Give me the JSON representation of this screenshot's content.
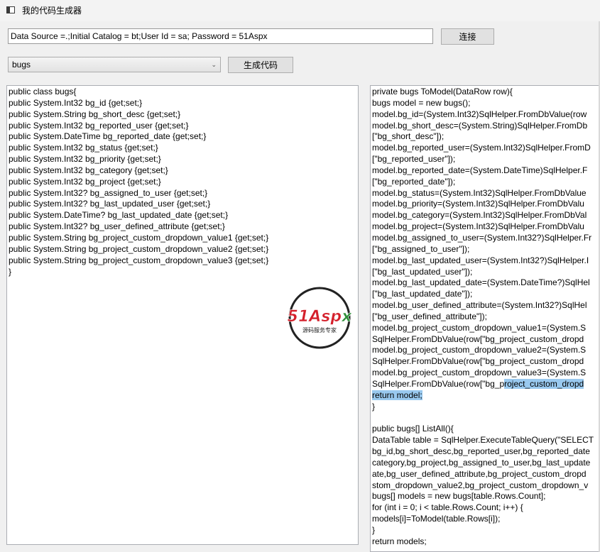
{
  "window": {
    "title": "我的代码生成器"
  },
  "connection": {
    "value": "Data Source =.;Initial Catalog = bt;User Id = sa; Password = 51Aspx",
    "connect_label": "连接"
  },
  "table_select": {
    "selected": "bugs"
  },
  "generate_label": "生成代码",
  "left_code": [
    "public class bugs{",
    "public System.Int32 bg_id {get;set;}",
    "public System.String bg_short_desc {get;set;}",
    "public System.Int32 bg_reported_user {get;set;}",
    "public System.DateTime bg_reported_date {get;set;}",
    "public System.Int32 bg_status {get;set;}",
    "public System.Int32 bg_priority {get;set;}",
    "public System.Int32 bg_category {get;set;}",
    "public System.Int32 bg_project {get;set;}",
    "public System.Int32? bg_assigned_to_user {get;set;}",
    "public System.Int32? bg_last_updated_user {get;set;}",
    "public System.DateTime? bg_last_updated_date {get;set;}",
    "public System.Int32? bg_user_defined_attribute {get;set;}",
    "public System.String bg_project_custom_dropdown_value1 {get;set;}",
    "public System.String bg_project_custom_dropdown_value2 {get;set;}",
    "public System.String bg_project_custom_dropdown_value3 {get;set;}",
    "}"
  ],
  "right_code": [
    "private bugs ToModel(DataRow row){",
    "bugs model = new bugs();",
    "model.bg_id=(System.Int32)SqlHelper.FromDbValue(row",
    "model.bg_short_desc=(System.String)SqlHelper.FromDb",
    "[\"bg_short_desc\"]);",
    "model.bg_reported_user=(System.Int32)SqlHelper.FromD",
    "[\"bg_reported_user\"]);",
    "model.bg_reported_date=(System.DateTime)SqlHelper.F",
    "[\"bg_reported_date\"]);",
    "model.bg_status=(System.Int32)SqlHelper.FromDbValue",
    "model.bg_priority=(System.Int32)SqlHelper.FromDbValu",
    "model.bg_category=(System.Int32)SqlHelper.FromDbVal",
    "model.bg_project=(System.Int32)SqlHelper.FromDbValu",
    "model.bg_assigned_to_user=(System.Int32?)SqlHelper.Fr",
    "[\"bg_assigned_to_user\"]);",
    "model.bg_last_updated_user=(System.Int32?)SqlHelper.I",
    "[\"bg_last_updated_user\"]);",
    "model.bg_last_updated_date=(System.DateTime?)SqlHel",
    "[\"bg_last_updated_date\"]);",
    "model.bg_user_defined_attribute=(System.Int32?)SqlHel",
    "[\"bg_user_defined_attribute\"]);",
    "model.bg_project_custom_dropdown_value1=(System.S",
    "SqlHelper.FromDbValue(row[\"bg_project_custom_dropd",
    "model.bg_project_custom_dropdown_value2=(System.S",
    "SqlHelper.FromDbValue(row[\"bg_project_custom_dropd",
    "model.bg_project_custom_dropdown_value3=(System.S",
    "SqlHelper.FromDbValue(row[\"bg_p",
    "return model;",
    "}",
    "",
    "public bugs[] ListAll(){",
    "DataTable table = SqlHelper.ExecuteTableQuery(\"SELECT",
    "bg_id,bg_short_desc,bg_reported_user,bg_reported_date",
    "category,bg_project,bg_assigned_to_user,bg_last_update",
    "ate,bg_user_defined_attribute,bg_project_custom_dropd",
    "stom_dropdown_value2,bg_project_custom_dropdown_v",
    "bugs[] models = new bugs[table.Rows.Count];",
    "for (int i = 0; i < table.Rows.Count; i++) {",
    "models[i]=ToModel(table.Rows[i]);",
    "}",
    "return models;"
  ],
  "right_code_selection": {
    "line_26_suffix": "roject_custom_dropd"
  },
  "watermark": {
    "brand": "51Aspx",
    "tagline": "源码服务专家"
  },
  "colors": {
    "selection": "#99c9ef",
    "watermark_red": "#d4202b",
    "watermark_green": "#2f8f3a"
  }
}
